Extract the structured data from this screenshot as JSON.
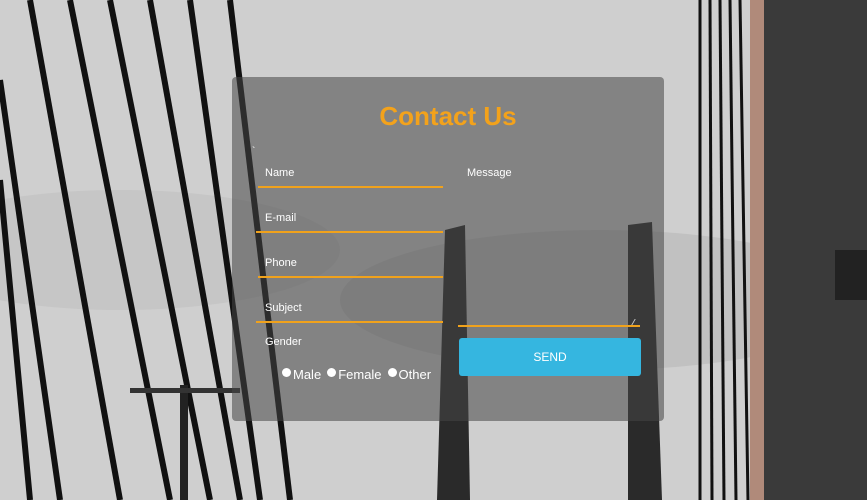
{
  "form": {
    "title": "Contact Us",
    "stray_mark": "`",
    "fields": {
      "name": {
        "placeholder": "Name"
      },
      "email": {
        "placeholder": "E-mail"
      },
      "phone": {
        "placeholder": "Phone"
      },
      "subject": {
        "placeholder": "Subject"
      },
      "message": {
        "placeholder": "Message"
      }
    },
    "gender": {
      "label": "Gender",
      "options": [
        "Male",
        "Female",
        "Other"
      ]
    },
    "send_label": "SEND"
  },
  "colors": {
    "title": "#f3a21b",
    "underline": "#f0a21c",
    "send_button": "#35b6e0",
    "panel": "rgba(70,70,70,0.55)"
  }
}
